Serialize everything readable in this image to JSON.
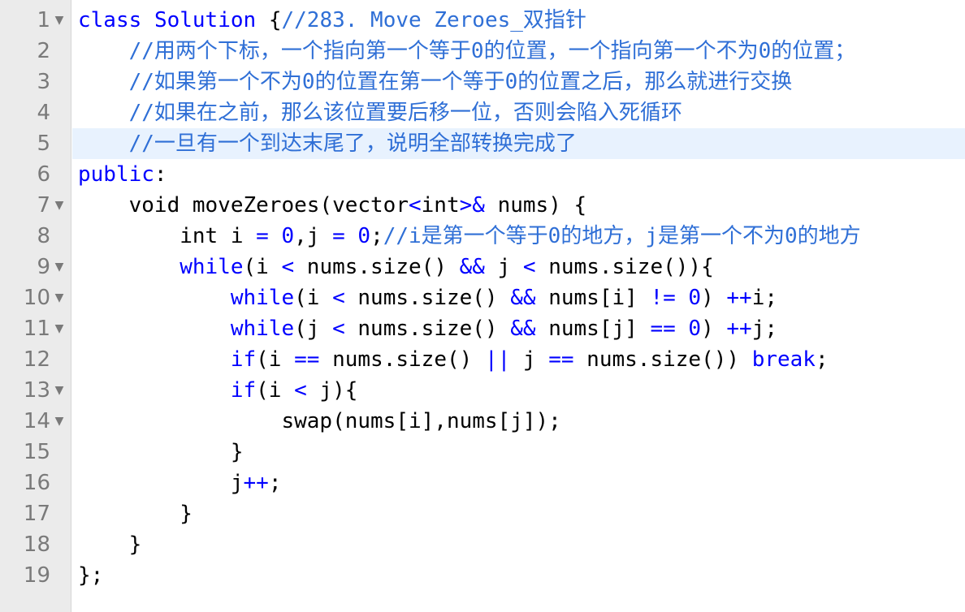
{
  "editor": {
    "lines": [
      {
        "n": "1",
        "fold": "▼",
        "tokens": [
          [
            "kw",
            "class"
          ],
          [
            "plain",
            " "
          ],
          [
            "ty",
            "Solution"
          ],
          [
            "plain",
            " {"
          ],
          [
            "cm",
            "//283. Move Zeroes_双指针"
          ]
        ]
      },
      {
        "n": "2",
        "fold": "",
        "tokens": [
          [
            "plain",
            "    "
          ],
          [
            "cm",
            "//用两个下标，一个指向第一个等于0的位置，一个指向第一个不为0的位置；"
          ]
        ]
      },
      {
        "n": "3",
        "fold": "",
        "tokens": [
          [
            "plain",
            "    "
          ],
          [
            "cm",
            "//如果第一个不为0的位置在第一个等于0的位置之后，那么就进行交换"
          ]
        ]
      },
      {
        "n": "4",
        "fold": "",
        "tokens": [
          [
            "plain",
            "    "
          ],
          [
            "cm",
            "//如果在之前，那么该位置要后移一位，否则会陷入死循环"
          ]
        ]
      },
      {
        "n": "5",
        "fold": "",
        "active": true,
        "tokens": [
          [
            "plain",
            "    "
          ],
          [
            "cm",
            "//一旦有一个到达末尾了，说明全部转换完成了"
          ]
        ]
      },
      {
        "n": "6",
        "fold": "",
        "tokens": [
          [
            "kw",
            "public"
          ],
          [
            "plain",
            ":"
          ]
        ]
      },
      {
        "n": "7",
        "fold": "▼",
        "tokens": [
          [
            "plain",
            "    void moveZeroes(vector"
          ],
          [
            "kw",
            "<"
          ],
          [
            "plain",
            "int"
          ],
          [
            "kw",
            ">&"
          ],
          [
            "plain",
            " nums) {"
          ]
        ]
      },
      {
        "n": "8",
        "fold": "",
        "tokens": [
          [
            "plain",
            "        int i "
          ],
          [
            "kw",
            "="
          ],
          [
            "plain",
            " "
          ],
          [
            "kw",
            "0"
          ],
          [
            "plain",
            ",j "
          ],
          [
            "kw",
            "="
          ],
          [
            "plain",
            " "
          ],
          [
            "kw",
            "0"
          ],
          [
            "plain",
            ";"
          ],
          [
            "cm",
            "//i是第一个等于0的地方，j是第一个不为0的地方"
          ]
        ]
      },
      {
        "n": "9",
        "fold": "▼",
        "tokens": [
          [
            "plain",
            "        "
          ],
          [
            "kw",
            "while"
          ],
          [
            "plain",
            "(i "
          ],
          [
            "kw",
            "<"
          ],
          [
            "plain",
            " nums.size() "
          ],
          [
            "kw",
            "&&"
          ],
          [
            "plain",
            " j "
          ],
          [
            "kw",
            "<"
          ],
          [
            "plain",
            " nums.size()){"
          ]
        ]
      },
      {
        "n": "10",
        "fold": "▼",
        "tokens": [
          [
            "plain",
            "            "
          ],
          [
            "kw",
            "while"
          ],
          [
            "plain",
            "(i "
          ],
          [
            "kw",
            "<"
          ],
          [
            "plain",
            " nums.size() "
          ],
          [
            "kw",
            "&&"
          ],
          [
            "plain",
            " nums[i] "
          ],
          [
            "kw",
            "!="
          ],
          [
            "plain",
            " "
          ],
          [
            "kw",
            "0"
          ],
          [
            "plain",
            ") "
          ],
          [
            "kw",
            "++"
          ],
          [
            "plain",
            "i;"
          ]
        ]
      },
      {
        "n": "11",
        "fold": "▼",
        "tokens": [
          [
            "plain",
            "            "
          ],
          [
            "kw",
            "while"
          ],
          [
            "plain",
            "(j "
          ],
          [
            "kw",
            "<"
          ],
          [
            "plain",
            " nums.size() "
          ],
          [
            "kw",
            "&&"
          ],
          [
            "plain",
            " nums[j] "
          ],
          [
            "kw",
            "=="
          ],
          [
            "plain",
            " "
          ],
          [
            "kw",
            "0"
          ],
          [
            "plain",
            ") "
          ],
          [
            "kw",
            "++"
          ],
          [
            "plain",
            "j;"
          ]
        ]
      },
      {
        "n": "12",
        "fold": "",
        "tokens": [
          [
            "plain",
            "            "
          ],
          [
            "kw",
            "if"
          ],
          [
            "plain",
            "(i "
          ],
          [
            "kw",
            "=="
          ],
          [
            "plain",
            " nums.size() "
          ],
          [
            "kw",
            "||"
          ],
          [
            "plain",
            " j "
          ],
          [
            "kw",
            "=="
          ],
          [
            "plain",
            " nums.size()) "
          ],
          [
            "kw",
            "break"
          ],
          [
            "plain",
            ";"
          ]
        ]
      },
      {
        "n": "13",
        "fold": "▼",
        "tokens": [
          [
            "plain",
            "            "
          ],
          [
            "kw",
            "if"
          ],
          [
            "plain",
            "(i "
          ],
          [
            "kw",
            "<"
          ],
          [
            "plain",
            " j){"
          ]
        ]
      },
      {
        "n": "14",
        "fold": "▼",
        "tokens": [
          [
            "plain",
            "                swap(nums[i],nums[j]);"
          ]
        ]
      },
      {
        "n": "15",
        "fold": "",
        "tokens": [
          [
            "plain",
            "            }"
          ]
        ]
      },
      {
        "n": "16",
        "fold": "",
        "tokens": [
          [
            "plain",
            "            j"
          ],
          [
            "kw",
            "++"
          ],
          [
            "plain",
            ";"
          ]
        ]
      },
      {
        "n": "17",
        "fold": "",
        "tokens": [
          [
            "plain",
            "        }"
          ]
        ]
      },
      {
        "n": "18",
        "fold": "",
        "tokens": [
          [
            "plain",
            "    }"
          ]
        ]
      },
      {
        "n": "19",
        "fold": "",
        "tokens": [
          [
            "plain",
            "};"
          ]
        ]
      }
    ]
  },
  "colors": {
    "keyword": "#0000ff",
    "comment": "#2f6fd6",
    "gutter_bg": "#ebebeb",
    "active_line_bg": "#e8f2fe",
    "line_number": "#7a7a7a"
  },
  "icons": {
    "fold": "chevron-down-icon"
  }
}
